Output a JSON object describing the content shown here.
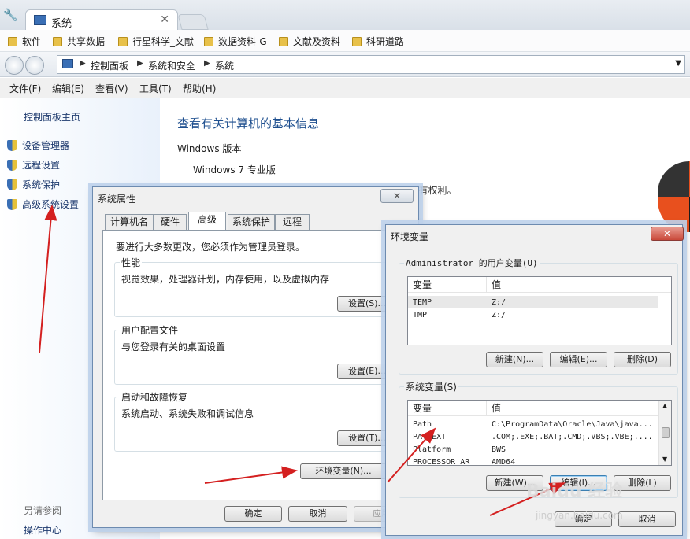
{
  "browser": {
    "tab_title": "系统",
    "bookmarks": [
      "软件",
      "共享数据",
      "行星科学_文献",
      "数据资料-G",
      "文献及资料",
      "科研道路"
    ],
    "breadcrumbs": [
      "控制面板",
      "系统和安全",
      "系统"
    ]
  },
  "menubar": [
    "文件(F)",
    "编辑(E)",
    "查看(V)",
    "工具(T)",
    "帮助(H)"
  ],
  "leftpanel": {
    "home": "控制面板主页",
    "links": [
      "设备管理器",
      "远程设置",
      "系统保护",
      "高级系统设置"
    ],
    "see_also": "另请参阅",
    "action_center": "操作中心"
  },
  "main": {
    "title": "查看有关计算机的基本信息",
    "windows_version_heading": "Windows 版本",
    "edition": "Windows 7 专业版",
    "copyright_tail": "有权利。"
  },
  "sysprops": {
    "title": "系统属性",
    "tabs": [
      "计算机名",
      "硬件",
      "高级",
      "系统保护",
      "远程"
    ],
    "admin_note": "要进行大多数更改，您必须作为管理员登录。",
    "groups": [
      {
        "title": "性能",
        "desc": "视觉效果，处理器计划，内存使用，以及虚拟内存",
        "button": "设置(S)..."
      },
      {
        "title": "用户配置文件",
        "desc": "与您登录有关的桌面设置",
        "button": "设置(E)..."
      },
      {
        "title": "启动和故障恢复",
        "desc": "系统启动、系统失败和调试信息",
        "button": "设置(T)..."
      }
    ],
    "env_button": "环境变量(N)...",
    "ok": "确定",
    "cancel": "取消",
    "apply": "应用"
  },
  "envvars": {
    "title": "环境变量",
    "user_section": "Administrator 的用户变量(U)",
    "col_var": "变量",
    "col_val": "值",
    "user_vars": [
      {
        "name": "TEMP",
        "value": "Z:/"
      },
      {
        "name": "TMP",
        "value": "Z:/"
      }
    ],
    "user_buttons": [
      "新建(N)...",
      "编辑(E)...",
      "删除(D)"
    ],
    "system_section": "系统变量(S)",
    "system_vars": [
      {
        "name": "Path",
        "value": "C:\\ProgramData\\Oracle\\Java\\java..."
      },
      {
        "name": "PATHEXT",
        "value": ".COM;.EXE;.BAT;.CMD;.VBS;.VBE;...."
      },
      {
        "name": "Platform",
        "value": "BWS"
      },
      {
        "name": "PROCESSOR_AR",
        "value": "AMD64"
      }
    ],
    "system_buttons": [
      "新建(W)...",
      "编辑(I)...",
      "删除(L)"
    ],
    "ok": "确定",
    "cancel": "取消"
  },
  "watermark": {
    "text": "Baidu 经验",
    "sub": "jingyan.baidu.com"
  }
}
